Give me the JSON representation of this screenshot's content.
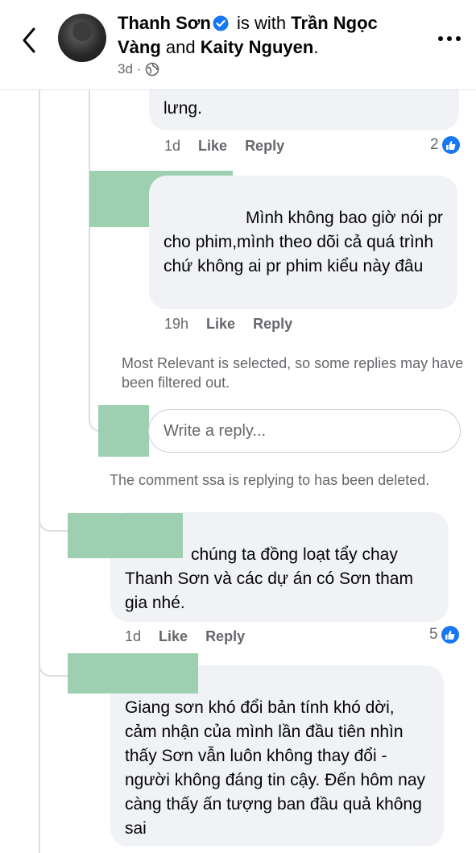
{
  "header": {
    "author": "Thanh Sơn",
    "with_text": " is with ",
    "tag1": "Trần Ngọc Vàng",
    "and_text": " and ",
    "tag2": "Kaity Nguyen",
    "period": ".",
    "time": "3d ·",
    "audience_icon": "globe-icon",
    "back_icon": "chevron-left-icon",
    "more_icon": "more-horizontal-icon"
  },
  "comments": [
    {
      "text": "lưng.",
      "time": "1d",
      "like_label": "Like",
      "reply_label": "Reply",
      "reactions": "2"
    },
    {
      "text": "Mình không bao giờ nói pr cho phim,mình theo dõi cả quá trình chứ không ai pr phim kiểu này đâu",
      "time": "19h",
      "like_label": "Like",
      "reply_label": "Reply"
    },
    {
      "text": "chúng ta đồng loạt tẩy chay Thanh Sơn và các dự án có Sơn tham gia nhé.",
      "time": "1d",
      "like_label": "Like",
      "reply_label": "Reply",
      "reactions": "5"
    },
    {
      "text": "Giang sơn khó đổi bản tính khó dời, cảm nhận của mình lần đầu tiên nhìn thấy Sơn vẫn luôn không thay đổi - người không đáng tin cậy. Đến hôm nay càng thấy ấn tượng ban đầu quả không sai"
    }
  ],
  "filter_note": "Most Relevant is selected, so some replies may have been filtered out.",
  "reply_input": {
    "placeholder": "Write a reply..."
  },
  "deleted_note": "The comment ssa is replying to has been deleted.",
  "colors": {
    "like_blue": "#1877f2",
    "redaction": "#9dcfb0",
    "bubble": "#f0f2f5"
  }
}
